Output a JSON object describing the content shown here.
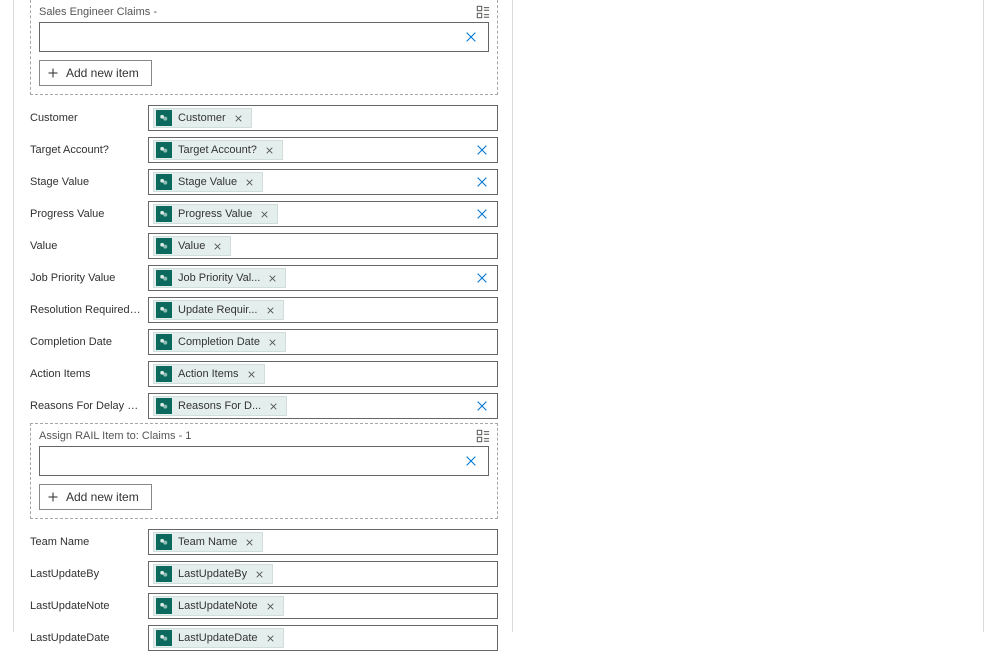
{
  "panel1": {
    "label": "Sales Engineer Claims -",
    "add_label": "Add new item"
  },
  "panel2": {
    "label": "Assign RAIL Item to: Claims - 1",
    "add_label": "Add new item"
  },
  "rows_top": [
    {
      "label": "Customer",
      "pill": "Customer",
      "truncated": false,
      "clear": false
    },
    {
      "label": "Target Account?",
      "pill": "Target Account?",
      "truncated": false,
      "clear": true
    },
    {
      "label": "Stage Value",
      "pill": "Stage Value",
      "truncated": false,
      "clear": true
    },
    {
      "label": "Progress Value",
      "pill": "Progress Value",
      "truncated": false,
      "clear": true
    },
    {
      "label": "Value",
      "pill": "Value",
      "truncated": false,
      "clear": false
    },
    {
      "label": "Job Priority Value",
      "pill": "Job Priority Val...",
      "truncated": true,
      "clear": true
    },
    {
      "label": "Resolution Required By",
      "pill": "Update Requir...",
      "truncated": true,
      "clear": false
    },
    {
      "label": "Completion Date",
      "pill": "Completion Date",
      "truncated": false,
      "clear": false
    },
    {
      "label": "Action Items",
      "pill": "Action Items",
      "truncated": false,
      "clear": false
    },
    {
      "label": "Reasons For Delay Value",
      "pill": "Reasons For D...",
      "truncated": true,
      "clear": true
    }
  ],
  "rows_bottom": [
    {
      "label": "Team Name",
      "pill": "Team Name",
      "truncated": false,
      "clear": false
    },
    {
      "label": "LastUpdateBy",
      "pill": "LastUpdateBy",
      "truncated": false,
      "clear": false
    },
    {
      "label": "LastUpdateNote",
      "pill": "LastUpdateNote",
      "truncated": false,
      "clear": false
    },
    {
      "label": "LastUpdateDate",
      "pill": "LastUpdateDate",
      "truncated": false,
      "clear": false
    }
  ]
}
